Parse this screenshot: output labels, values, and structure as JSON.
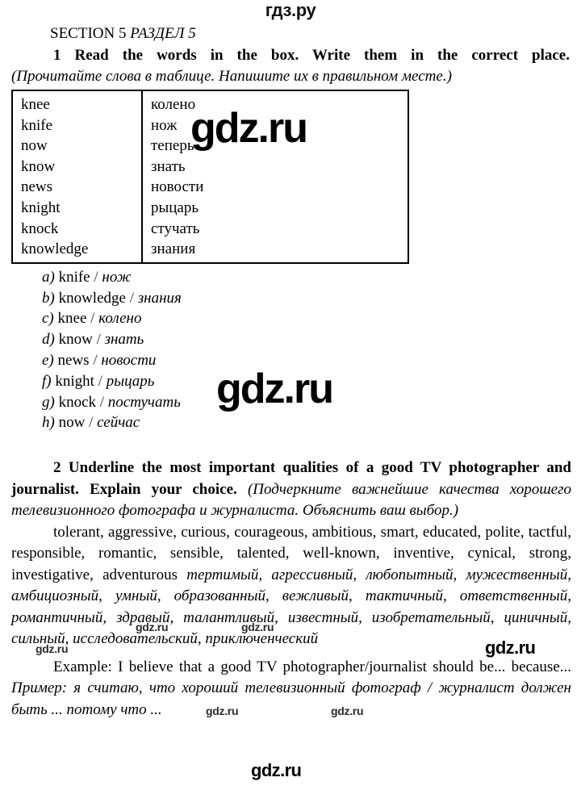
{
  "watermarks": {
    "logo_top": "гдз.ру",
    "brand": "gdz.ru"
  },
  "section": {
    "label_en": "SECTION 5",
    "label_ru": "РАЗДЕЛ 5"
  },
  "exercise1": {
    "number": "1",
    "instruction_en": "Read the words in the box. Write them in the correct place.",
    "instruction_ru": "(Прочитайте слова в таблице. Напишите их в правильном месте.)",
    "table": {
      "rows": [
        {
          "en": "knee",
          "ru": "колено"
        },
        {
          "en": "knife",
          "ru": "нож"
        },
        {
          "en": "now",
          "ru": "теперь"
        },
        {
          "en": "know",
          "ru": "знать"
        },
        {
          "en": "news",
          "ru": "новости"
        },
        {
          "en": "knight",
          "ru": "рыцарь"
        },
        {
          "en": "knock",
          "ru": "стучать"
        },
        {
          "en": "knowledge",
          "ru": "знания"
        }
      ]
    },
    "answers": [
      {
        "label": "a)",
        "en": "knife",
        "sep": "/",
        "ru": "нож"
      },
      {
        "label": "b)",
        "en": "knowledge",
        "sep": "/",
        "ru": "знания"
      },
      {
        "label": "c)",
        "en": "knee",
        "sep": "/",
        "ru": "колено"
      },
      {
        "label": "d)",
        "en": "know",
        "sep": "/",
        "ru": "знать"
      },
      {
        "label": "e)",
        "en": "news",
        "sep": "/",
        "ru": "новости"
      },
      {
        "label": "f)",
        "en": "knight",
        "sep": "/",
        "ru": "рыцарь"
      },
      {
        "label": "g)",
        "en": "knock",
        "sep": "/",
        "ru": "постучать"
      },
      {
        "label": "h)",
        "en": "now",
        "sep": "/",
        "ru": "сейчас"
      }
    ]
  },
  "exercise2": {
    "number": "2",
    "instruction_en": "Underline the most important qualities of a good TV photographer and journalist. Explain your choice.",
    "instruction_ru": "(Подчеркните важнейшие качества хорошего телевизионного фотографа и журналиста. Объяснить ваш выбор.)",
    "qualities_en": "tolerant, aggressive, curious, courageous, ambitious, smart, educated, polite, tactful, responsible, romantic, sensible, talented, well-known, inventive, cynical, strong, investigative, adventurous",
    "qualities_ru": "тертимый, агрессивный, любопытный, мужественный, амбициозный, умный, образованный, вежливый, тактичный, ответственный, романтичный, здравый, талантливый, известный, изобретательный, циничный, сильный, исследовательский, приключенческий",
    "example_en": "Example: I believe that a good TV photographer/journalist should be... because...",
    "example_ru": "Пример: я считаю, что хороший телевизионный фотограф / журналист должен быть ... потому что ..."
  }
}
